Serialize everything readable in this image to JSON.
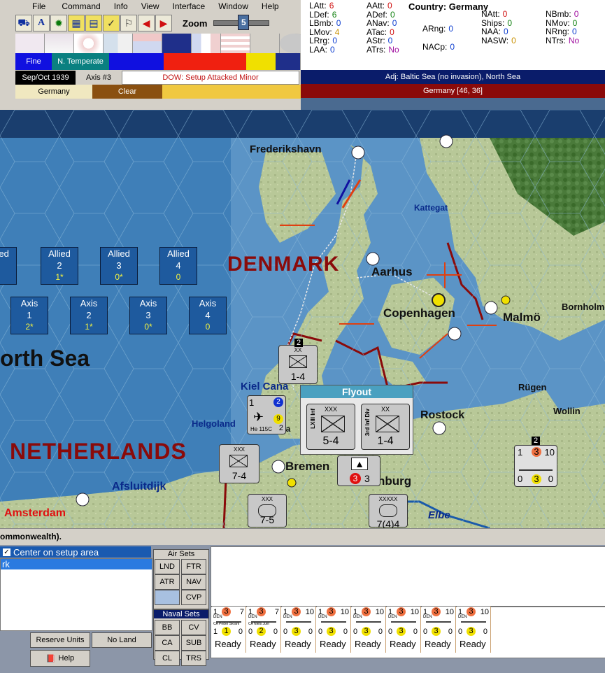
{
  "menu": [
    "File",
    "Command",
    "Info",
    "View",
    "Interface",
    "Window",
    "Help"
  ],
  "toolbar": {
    "zoom_label": "Zoom",
    "zoom_value": "5"
  },
  "info_row": {
    "weather": "Fine",
    "climate": "N. Temperate"
  },
  "turn_row": {
    "date": "Sep/Oct 1939",
    "side": "Axis #3",
    "phase": "DOW: Setup Attacked Minor",
    "adjacent": "Adj: Baltic Sea (no invasion), North Sea"
  },
  "terrain_row": {
    "country": "Germany",
    "weather2": "Clear",
    "hex": "Germany [46, 36]"
  },
  "stats": {
    "col1": [
      [
        "LAtt:",
        "6"
      ],
      [
        "LDef:",
        "6"
      ],
      [
        "LBmb:",
        "0"
      ],
      [
        "LMov:",
        "4"
      ],
      [
        "LRrg:",
        "0"
      ],
      [
        "LAA:",
        "0"
      ]
    ],
    "col2": [
      [
        "AAtt:",
        "0"
      ],
      [
        "ADef:",
        "0"
      ],
      [
        "ANav:",
        "0"
      ],
      [
        "ATac:",
        "0"
      ],
      [
        "AStr:",
        "0"
      ],
      [
        "ATrs:",
        "No"
      ]
    ],
    "country": "Country: Germany",
    "col3": [
      [
        "ARng:",
        "0"
      ],
      [
        "NACp:",
        "0"
      ]
    ],
    "col4": [
      [
        "NAtt:",
        "0"
      ],
      [
        "Ships:",
        "0"
      ],
      [
        "NAA:",
        "0"
      ],
      [
        "NASW:",
        "0"
      ]
    ],
    "col5": [
      [
        "NBmb:",
        "0"
      ],
      [
        "NMov:",
        "0"
      ],
      [
        "NRng:",
        "0"
      ],
      [
        "NTrs:",
        "No"
      ]
    ]
  },
  "map_labels": {
    "frederikshavn": "Frederikshavn",
    "kattegat": "Kattegat",
    "denmark": "DENMARK",
    "aarhus": "Aarhus",
    "copenhagen": "Copenhagen",
    "malmo": "Malmö",
    "bornholm": "Bornholm",
    "northsea": "orth Sea",
    "kiel": "Kiel Cana",
    "helgoland": "Helgoland",
    "rugen": "Rügen",
    "wollin": "Wollin",
    "rostock": "Rostock",
    "netherlands": "NETHERLANDS",
    "bremen": "Bremen",
    "afsluitdijk": "Afsluitdijk",
    "amsterdam": "Amsterdam",
    "elbe": "Elbe",
    "hamburg": "nburg",
    "wilhelmsh": "ilhelmsha"
  },
  "reserves": {
    "allied": [
      {
        "label": "Allied",
        "num": "1",
        "val": "*"
      },
      {
        "label": "Allied",
        "num": "2",
        "val": "1*"
      },
      {
        "label": "Allied",
        "num": "3",
        "val": "0*"
      },
      {
        "label": "Allied",
        "num": "4",
        "val": "0"
      }
    ],
    "axis": [
      {
        "label": "Axis",
        "num": "1",
        "val": "2*"
      },
      {
        "label": "Axis",
        "num": "2",
        "val": "1*"
      },
      {
        "label": "Axis",
        "num": "3",
        "val": "0*"
      },
      {
        "label": "Axis",
        "num": "4",
        "val": "0"
      }
    ]
  },
  "flyout": {
    "title": "Flyout",
    "units": [
      {
        "name": "LXIII Inf",
        "size": "XXX",
        "strength": "5-4"
      },
      {
        "name": "3rd Inf Div",
        "size": "XX",
        "strength": "1-4"
      }
    ]
  },
  "units": {
    "div3": {
      "name": "3rd Inf Div",
      "size": "XX",
      "strength": "1-4",
      "stack": "2"
    },
    "air": {
      "name": "He 115C",
      "left": "1",
      "top_right": "2",
      "badge": "9",
      "bottom_right": "2"
    },
    "xinf": {
      "name": "X Inf",
      "size": "XXX",
      "strength": "7-4"
    },
    "xliii": {
      "name": "XLVIII Arm",
      "size": "XXX",
      "strength": "7-5"
    },
    "naval": {
      "name": "SS",
      "badge": "3",
      "count": "3"
    },
    "hq": {
      "name": "Kesselring",
      "size": "XXXXX",
      "strength": "7(4)4"
    },
    "ship_right": {
      "stack": "2",
      "tl": "1",
      "tm": "3",
      "tr": "10",
      "bl": "0",
      "bm": "3",
      "br": "0"
    }
  },
  "status_text": "ommonwealth).",
  "bottom": {
    "center_checkbox": "Center on setup area",
    "list_item": "rk",
    "air_sets_title": "Air Sets",
    "air_sets": [
      "LND",
      "FTR",
      "ATR",
      "NAV",
      "",
      "CVP"
    ],
    "naval_sets_title": "Naval Sets",
    "naval_sets": [
      "BB",
      "CV",
      "CA",
      "SUB",
      "CL",
      "TRS"
    ],
    "reserve_button": "Reserve Units",
    "noland_button": "No Land",
    "help_button": "Help",
    "ships": [
      {
        "nat": "DEN",
        "name": "CA Peder Skram",
        "tl": "1",
        "tm": "3",
        "tr": "7",
        "bl": "1",
        "bm": "1",
        "br": "0",
        "status": "Ready"
      },
      {
        "nat": "DEN",
        "name": "CA Niels Juel",
        "tl": "1",
        "tm": "3",
        "tr": "7",
        "bl": "0",
        "bm": "2",
        "br": "0",
        "status": "Ready"
      },
      {
        "nat": "DEN",
        "name": "",
        "tl": "1",
        "tm": "3",
        "tr": "10",
        "bl": "0",
        "bm": "3",
        "br": "0",
        "status": "Ready"
      },
      {
        "nat": "DEN",
        "name": "",
        "tl": "1",
        "tm": "3",
        "tr": "10",
        "bl": "0",
        "bm": "3",
        "br": "0",
        "status": "Ready"
      },
      {
        "nat": "DEN",
        "name": "",
        "tl": "1",
        "tm": "3",
        "tr": "10",
        "bl": "0",
        "bm": "3",
        "br": "0",
        "status": "Ready"
      },
      {
        "nat": "DEN",
        "name": "",
        "tl": "1",
        "tm": "3",
        "tr": "10",
        "bl": "0",
        "bm": "3",
        "br": "0",
        "status": "Ready"
      },
      {
        "nat": "DEN",
        "name": "",
        "tl": "1",
        "tm": "3",
        "tr": "10",
        "bl": "0",
        "bm": "3",
        "br": "0",
        "status": "Ready"
      },
      {
        "nat": "DEN",
        "name": "",
        "tl": "1",
        "tm": "3",
        "tr": "10",
        "bl": "0",
        "bm": "3",
        "br": "0",
        "status": "Ready"
      }
    ]
  }
}
